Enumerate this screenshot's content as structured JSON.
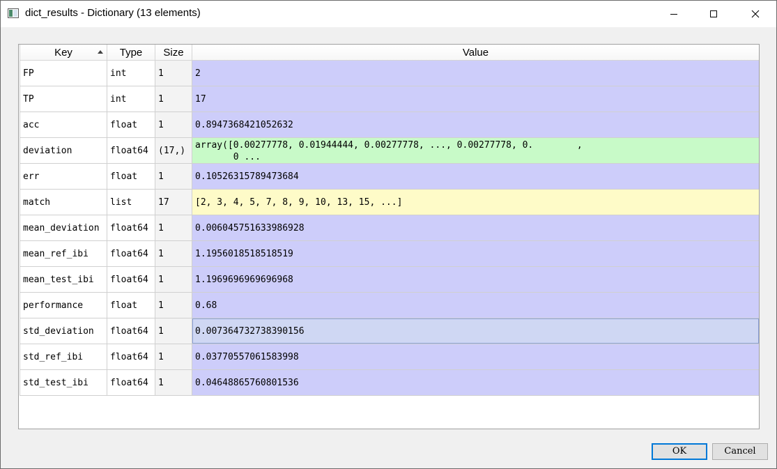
{
  "window": {
    "title": "dict_results - Dictionary (13 elements)"
  },
  "colors": {
    "numeric_value_bg": "#cdcdfa",
    "array_value_bg": "#c8fac8",
    "list_value_bg": "#fefbc8",
    "selected_value_bg": "#cfd7f3"
  },
  "table": {
    "headers": {
      "key": "Key",
      "type": "Type",
      "size": "Size",
      "value": "Value"
    },
    "sort": {
      "column": "Key",
      "direction": "ascending"
    },
    "rows": [
      {
        "key": "FP",
        "type": "int",
        "size": "1",
        "value": "2",
        "kind": "numeric"
      },
      {
        "key": "TP",
        "type": "int",
        "size": "1",
        "value": "17",
        "kind": "numeric"
      },
      {
        "key": "acc",
        "type": "float",
        "size": "1",
        "value": "0.8947368421052632",
        "kind": "numeric"
      },
      {
        "key": "deviation",
        "type": "float64",
        "size": "(17,)",
        "value": "array([0.00277778, 0.01944444, 0.00277778, ..., 0.00277778, 0.        ,\n       0 ...",
        "kind": "array"
      },
      {
        "key": "err",
        "type": "float",
        "size": "1",
        "value": "0.10526315789473684",
        "kind": "numeric"
      },
      {
        "key": "match",
        "type": "list",
        "size": "17",
        "value": "[2, 3, 4, 5, 7, 8, 9, 10, 13, 15, ...]",
        "kind": "list"
      },
      {
        "key": "mean_deviation",
        "type": "float64",
        "size": "1",
        "value": "0.006045751633986928",
        "kind": "numeric"
      },
      {
        "key": "mean_ref_ibi",
        "type": "float64",
        "size": "1",
        "value": "1.1956018518518519",
        "kind": "numeric"
      },
      {
        "key": "mean_test_ibi",
        "type": "float64",
        "size": "1",
        "value": "1.1969696969696968",
        "kind": "numeric"
      },
      {
        "key": "performance",
        "type": "float",
        "size": "1",
        "value": "0.68",
        "kind": "numeric"
      },
      {
        "key": "std_deviation",
        "type": "float64",
        "size": "1",
        "value": "0.007364732738390156",
        "kind": "numeric",
        "selected": true
      },
      {
        "key": "std_ref_ibi",
        "type": "float64",
        "size": "1",
        "value": "0.03770557061583998",
        "kind": "numeric"
      },
      {
        "key": "std_test_ibi",
        "type": "float64",
        "size": "1",
        "value": "0.04648865760801536",
        "kind": "numeric"
      }
    ]
  },
  "buttons": {
    "ok": "OK",
    "cancel": "Cancel"
  },
  "icons": {
    "app": "window-app-icon",
    "minimize": "minimize-icon",
    "maximize": "maximize-icon",
    "close": "close-icon",
    "sort": "sort-ascending-icon"
  }
}
